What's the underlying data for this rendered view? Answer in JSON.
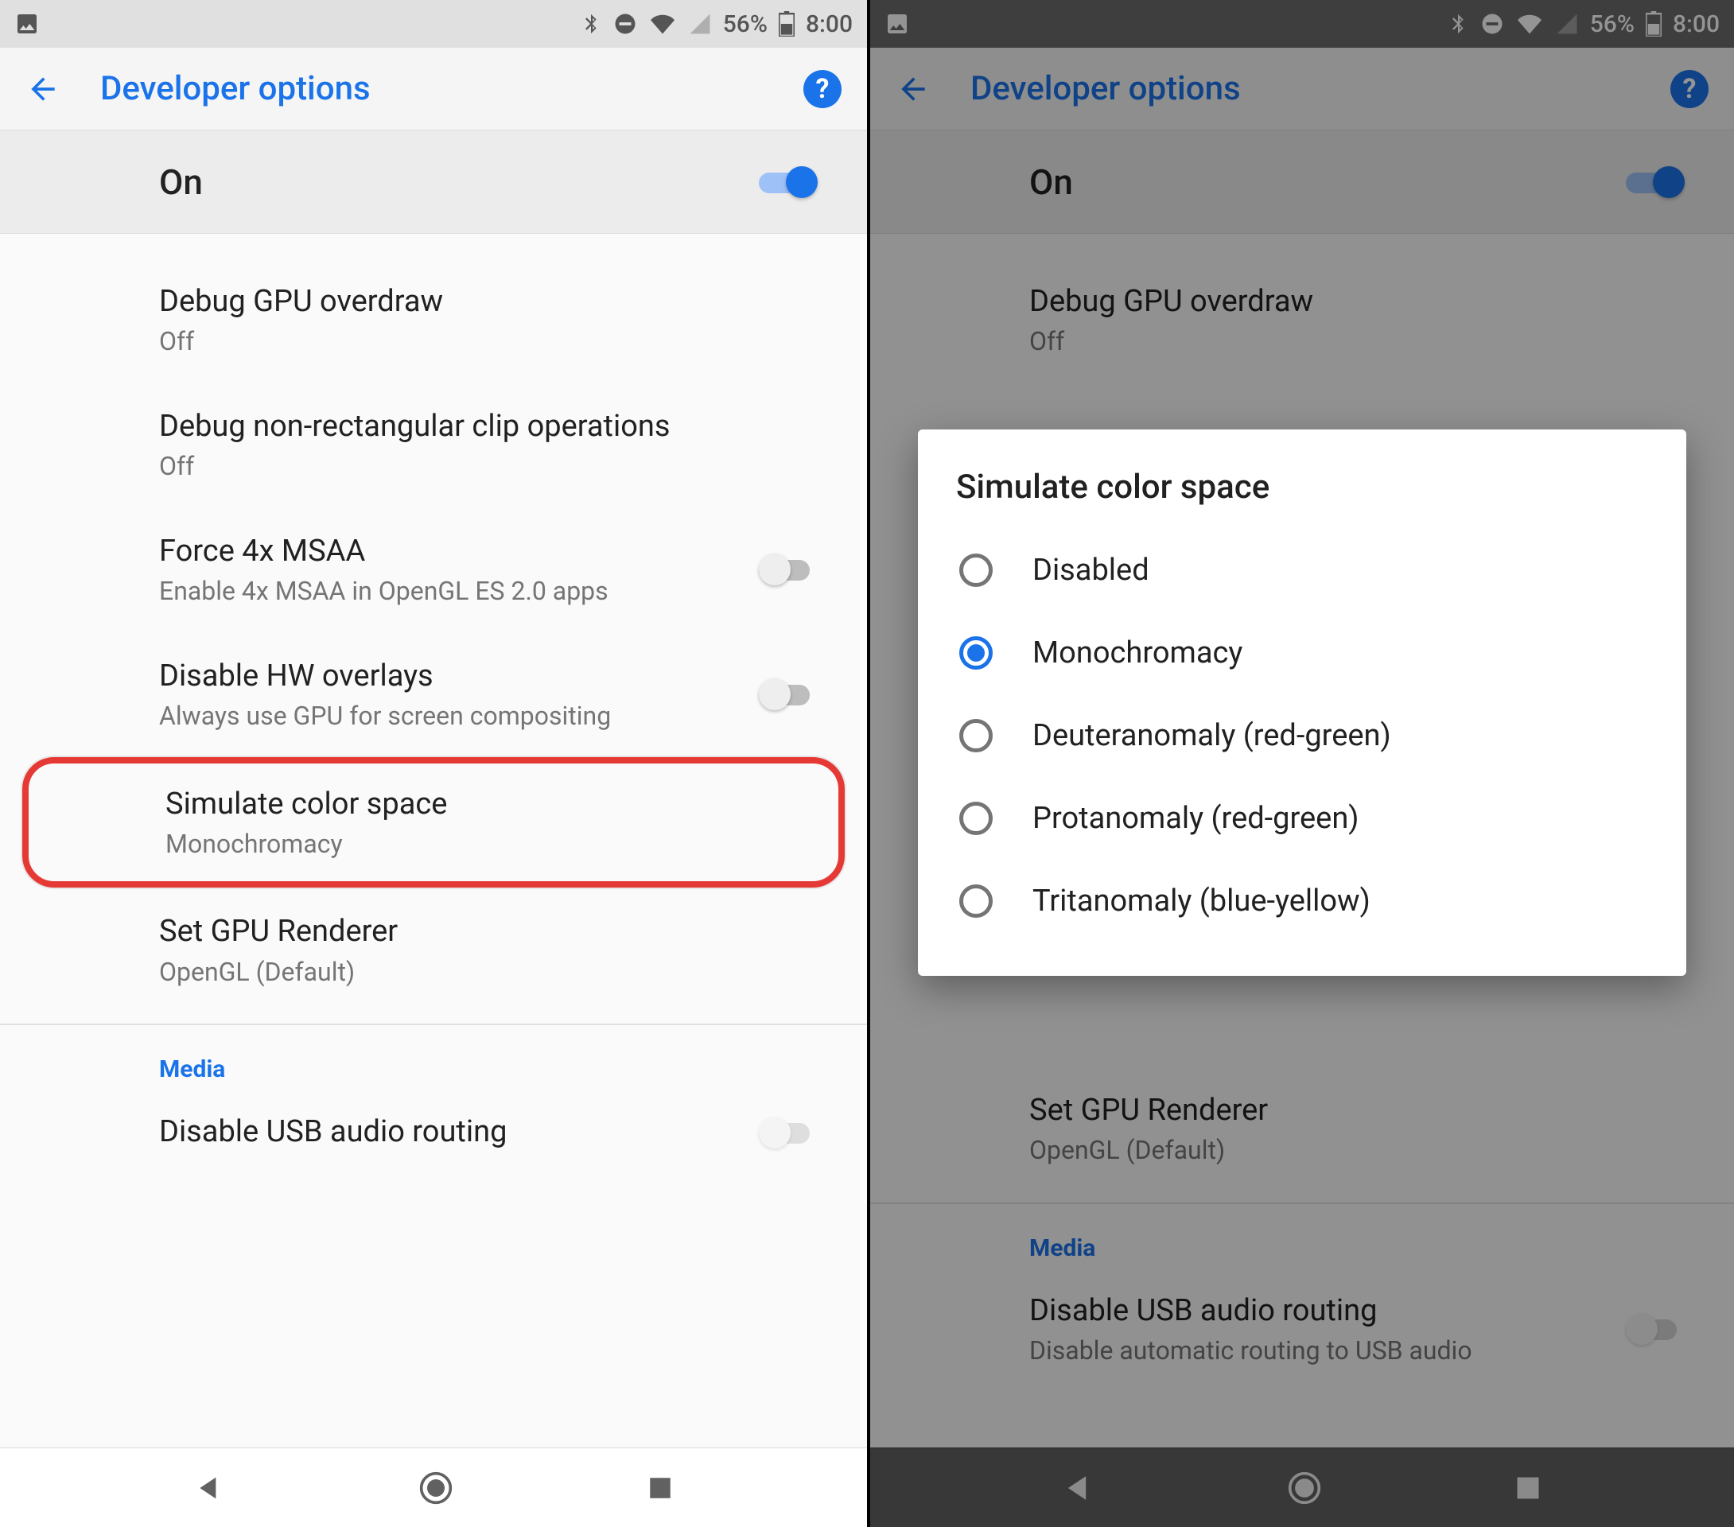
{
  "status": {
    "battery": "56%",
    "time": "8:00"
  },
  "appbar": {
    "title": "Developer options"
  },
  "master": {
    "label": "On",
    "on": true
  },
  "left": {
    "items": [
      {
        "title": "Debug GPU overdraw",
        "sub": "Off"
      },
      {
        "title": "Debug non-rectangular clip operations",
        "sub": "Off"
      },
      {
        "title": "Force 4x MSAA",
        "sub": "Enable 4x MSAA in OpenGL ES 2.0 apps",
        "toggle": false
      },
      {
        "title": "Disable HW overlays",
        "sub": "Always use GPU for screen compositing",
        "toggle": false
      },
      {
        "title": "Simulate color space",
        "sub": "Monochromacy",
        "highlight": true
      },
      {
        "title": "Set GPU Renderer",
        "sub": "OpenGL (Default)"
      }
    ],
    "section": "Media",
    "last": {
      "title": "Disable USB audio routing"
    }
  },
  "right": {
    "bg": [
      {
        "title": "Debug GPU overdraw",
        "sub": "Off"
      },
      {
        "title": "Set GPU Renderer",
        "sub": "OpenGL (Default)"
      }
    ],
    "section": "Media",
    "last": {
      "title": "Disable USB audio routing",
      "sub": "Disable automatic routing to USB audio"
    },
    "dialog": {
      "title": "Simulate color space",
      "options": [
        {
          "label": "Disabled",
          "selected": false
        },
        {
          "label": "Monochromacy",
          "selected": true
        },
        {
          "label": "Deuteranomaly (red-green)",
          "selected": false
        },
        {
          "label": "Protanomaly (red-green)",
          "selected": false
        },
        {
          "label": "Tritanomaly (blue-yellow)",
          "selected": false
        }
      ]
    }
  }
}
